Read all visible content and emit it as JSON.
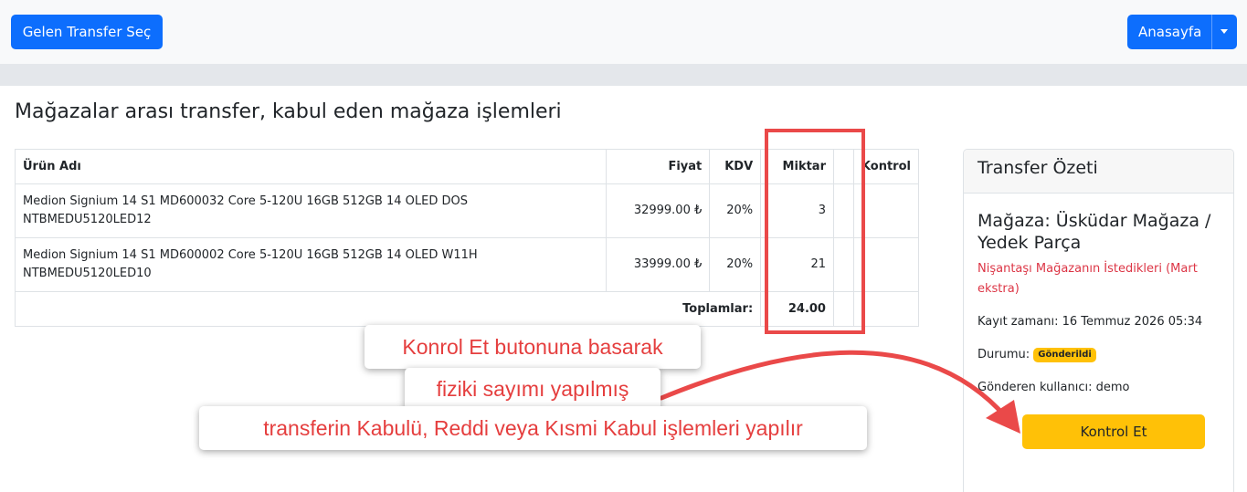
{
  "header": {
    "transfer_button": "Gelen Transfer Seç",
    "home_button": "Anasayfa"
  },
  "page_title": "Mağazalar arası transfer, kabul eden mağaza işlemleri",
  "table": {
    "headers": {
      "name": "Ürün Adı",
      "price": "Fiyat",
      "kdv": "KDV",
      "qty": "Miktar",
      "control": "Kontrol"
    },
    "rows": [
      {
        "name": "Medion Signium 14 S1 MD600032 Core 5-120U 16GB 512GB 14 OLED DOS",
        "code": "NTBMEDU5120LED12",
        "price": "32999.00 ₺",
        "kdv": "20%",
        "qty": "3"
      },
      {
        "name": "Medion Signium 14 S1 MD600002 Core 5-120U 16GB 512GB 14 OLED W11H",
        "code": "NTBMEDU5120LED10",
        "price": "33999.00 ₺",
        "kdv": "20%",
        "qty": "21"
      }
    ],
    "total_label": "Toplamlar:",
    "total_qty": "24.00"
  },
  "summary": {
    "title": "Transfer Özeti",
    "store": "Mağaza: Üsküdar Mağaza / Yedek Parça",
    "note": "Nişantaşı Mağazanın İstedikleri (Mart ekstra)",
    "record_time": "Kayıt zamanı: 16 Temmuz 2026 05:34",
    "status_label": "Durumu:",
    "status_badge": "Gönderildi",
    "sender": "Gönderen kullanıcı: demo",
    "control_button": "Kontrol Et"
  },
  "annotations": {
    "line1": "Konrol Et butonuna basarak",
    "line2": "fiziki sayımı yapılmış",
    "line3": "transferin Kabulü, Reddi veya Kısmi Kabul işlemleri yapılır",
    "color": "#e53e3e"
  },
  "colors": {
    "primary": "#0d6efd",
    "warning": "#ffc107",
    "danger": "#dc3545",
    "highlight": "#ea4949"
  }
}
